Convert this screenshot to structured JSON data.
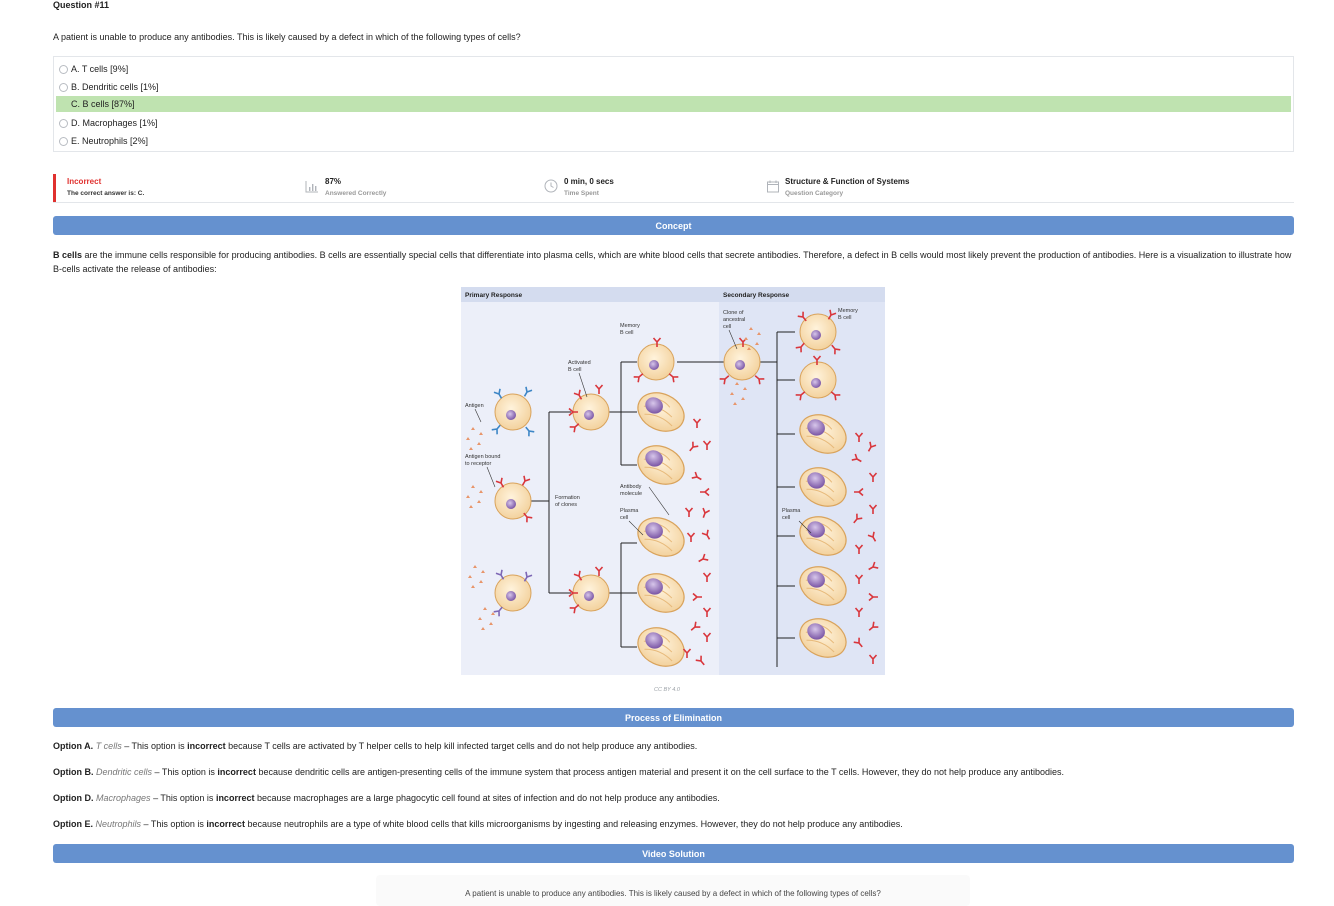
{
  "question": {
    "number": "Question #11",
    "stem": "A patient is unable to produce any antibodies. This is likely caused by a defect in which of the following types of cells?",
    "choices": [
      {
        "label": "A. T cells [9%]"
      },
      {
        "label": "B. Dendritic cells [1%]"
      },
      {
        "label": "C. B cells [87%]"
      },
      {
        "label": "D. Macrophages [1%]"
      },
      {
        "label": "E. Neutrophils [2%]"
      }
    ]
  },
  "stats": {
    "result": "Incorrect",
    "correct_answer": "The correct answer is: C.",
    "percent": "87%",
    "percent_label": "Answered Correctly",
    "time": "0 min, 0 secs",
    "time_label": "Time Spent",
    "category": "Structure & Function of Systems",
    "category_label": "Question Category"
  },
  "sections": {
    "concept": "Concept",
    "elimination": "Process of Elimination",
    "video": "Video Solution"
  },
  "concept": {
    "bold_term": "B cells",
    "text": " are the immune cells responsible for producing antibodies. B cells are essentially special cells that differentiate into plasma cells, which are white blood cells that secrete antibodies. Therefore, a defect in B cells would most likely prevent the production of antibodies. Here is a visualization to illustrate how B-cells activate the release of antibodies:"
  },
  "figure": {
    "primary": "Primary Response",
    "secondary": "Secondary Response",
    "labels": {
      "antigen": "Antigen",
      "antigen_bound_1": "Antigen bound",
      "antigen_bound_2": "to receptor",
      "activated_1": "Activated",
      "activated_2": "B cell",
      "memory_1": "Memory",
      "memory_2": "B cell",
      "formation_1": "Formation",
      "formation_2": "of clones",
      "antibody_1": "Antibody",
      "antibody_2": "molecule",
      "plasma_1": "Plasma",
      "plasma_2": "cell",
      "clone_1": "Clone of",
      "clone_2": "ancestral",
      "clone_3": "cell",
      "memory2_1": "Memory",
      "memory2_2": "B cell",
      "plasma2_1": "Plasma",
      "plasma2_2": "cell"
    },
    "credit": "CC BY 4.0"
  },
  "elimination": [
    {
      "option": "Option A.",
      "name": "T cells",
      "pre": " – This option is ",
      "verdict": "incorrect",
      "post": " because T cells are activated by T helper cells to help kill infected target cells and do not help produce any antibodies."
    },
    {
      "option": "Option B.",
      "name": "Dendritic cells",
      "pre": " – This option is ",
      "verdict": "incorrect",
      "post": " because dendritic cells are antigen-presenting cells of the immune system that process antigen material and present it on the cell surface to the T cells. However, they do not help produce any antibodies."
    },
    {
      "option": "Option D.",
      "name": "Macrophages",
      "pre": " – This option is ",
      "verdict": "incorrect",
      "post": " because macrophages are a large phagocytic cell found at sites of infection and do not help produce any antibodies."
    },
    {
      "option": "Option E.",
      "name": "Neutrophils",
      "pre": " – This option is ",
      "verdict": "incorrect",
      "post": " because neutrophils are a type of white blood cells that kills microorganisms by ingesting and releasing enzymes. However, they do not help produce any antibodies."
    }
  ],
  "video": {
    "caption": "A patient is unable to produce any antibodies. This is likely caused by a defect in which of the following types of cells?"
  },
  "colors": {
    "section_bar": "#6591cf",
    "correct_highlight": "#bfe3b0",
    "incorrect_red": "#e0312f"
  }
}
